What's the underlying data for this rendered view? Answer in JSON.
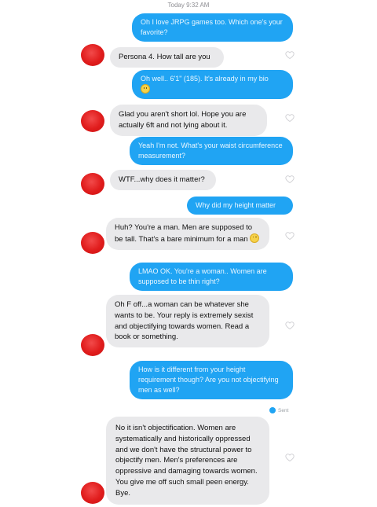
{
  "header": {
    "timestamp": "Today 9:32 AM"
  },
  "messages": [
    {
      "from": "me",
      "text": "Oh I love JRPG games too. Which one's your favorite?"
    },
    {
      "from": "them",
      "text": "Persona 4. How tall are you"
    },
    {
      "from": "me",
      "text": "Oh well.. 6'1\" (185). It's already in my bio",
      "emoji": "smiling-face"
    },
    {
      "from": "them",
      "text": "Glad you aren't short lol. Hope you are actually 6ft and not lying about it."
    },
    {
      "from": "me",
      "text": "Yeah I'm not. What's your waist circumference measurement?"
    },
    {
      "from": "them",
      "text": "WTF...why does it matter?"
    },
    {
      "from": "me",
      "text": "Why did my height matter"
    },
    {
      "from": "them",
      "text": "Huh? You're a man. Men are supposed to be tall. That's a bare minimum for a man",
      "emoji": "flushed-face"
    },
    {
      "from": "me",
      "text": "LMAO OK. You're a woman.. Women are supposed to be thin right?"
    },
    {
      "from": "them",
      "text": "Oh F off...a woman can be whatever she wants to be. Your reply is extremely sexist and objectifying towards women. Read a book or something."
    },
    {
      "from": "me",
      "text": "How is it different from your height requirement though? Are you not objectifying men as well?"
    },
    {
      "from": "them",
      "text": "No it isn't objectification. Women are systematically and historically oppressed and we don't have the structural power to objectify men. Men's preferences are oppressive and damaging towards women. You give me off such small peen energy. Bye."
    }
  ],
  "status": {
    "sent_label": "Sent"
  },
  "colors": {
    "outgoing": "#20a4f3",
    "incoming": "#e9e9eb",
    "avatar": "#e01c1c"
  },
  "icons": {
    "like": "heart-outline-icon",
    "avatar": "avatar-redacted",
    "sent": "sent-avatar-icon"
  }
}
